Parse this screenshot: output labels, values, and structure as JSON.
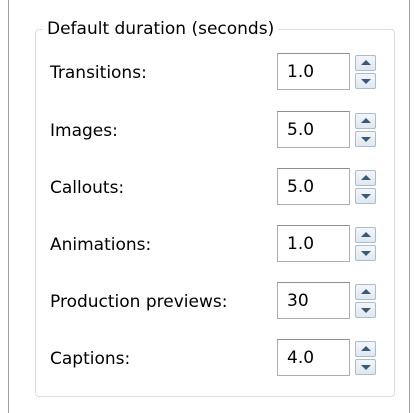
{
  "group": {
    "title": "Default duration (seconds)"
  },
  "fields": [
    {
      "label": "Transitions:",
      "value": "1.0"
    },
    {
      "label": "Images:",
      "value": "5.0"
    },
    {
      "label": "Callouts:",
      "value": "5.0"
    },
    {
      "label": "Animations:",
      "value": "1.0"
    },
    {
      "label": "Production previews:",
      "value": "30"
    },
    {
      "label": "Captions:",
      "value": "4.0"
    }
  ],
  "icons": {
    "up": "spin-up-arrow-icon",
    "down": "spin-down-arrow-icon"
  },
  "colors": {
    "group_border": "#d5dfe5",
    "spin_button_border": "#a9bcd0",
    "arrow": "#3a5a7c"
  }
}
